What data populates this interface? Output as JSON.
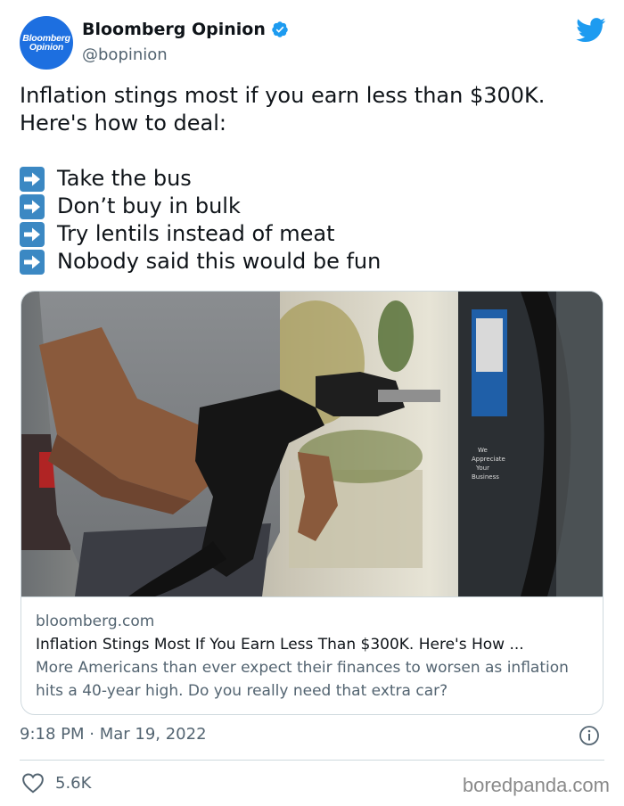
{
  "author": {
    "avatar_line1": "Bloomberg",
    "avatar_line2": "Opinion",
    "name": "Bloomberg Opinion",
    "handle": "@bopinion",
    "verified_icon": "verified-badge-icon",
    "platform_icon": "twitter-bird-icon"
  },
  "tweet": {
    "line1": "Inflation stings most if you earn less than $300K.",
    "line2": "Here's how to deal:",
    "bullets": [
      "Take the bus",
      "Don’t buy in bulk",
      "Try lentils instead of meat",
      "Nobody said this would be fun"
    ],
    "bullet_icon": "right-arrow-emoji-icon"
  },
  "link_card": {
    "domain": "bloomberg.com",
    "title": "Inflation Stings Most If You Earn Less Than $300K. Here's How ...",
    "description": "More Americans than ever expect their finances to worsen as inflation hits a 40-year high. Do you really need that extra car?",
    "image_pump_text": [
      "We",
      "Appreciate",
      "Your",
      "Business"
    ]
  },
  "meta": {
    "timestamp": "9:18 PM · Mar 19, 2022",
    "likes": "5.6K"
  },
  "watermark": "boredpanda.com",
  "colors": {
    "twitter_blue": "#1d9bf0",
    "avatar_blue": "#1d6fe0",
    "arrow_blue": "#3b88c3",
    "secondary_text": "#536471",
    "border": "#cfd9de"
  }
}
